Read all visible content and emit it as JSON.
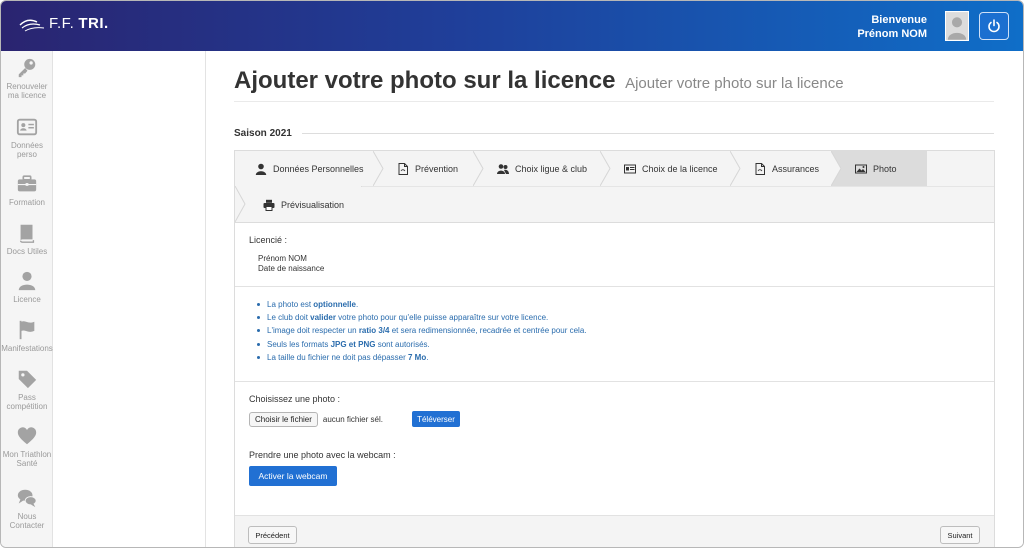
{
  "header": {
    "logo_prefix": "F.F.",
    "logo_tri": "TRI.",
    "welcome": "Bienvenue",
    "user_name": "Prénom NOM"
  },
  "sidebar": {
    "items": [
      {
        "label": "Renouveler ma licence",
        "icon": "key-icon"
      },
      {
        "label": "Données perso",
        "icon": "id-card-icon"
      },
      {
        "label": "Formation",
        "icon": "briefcase-icon"
      },
      {
        "label": "Docs Utiles",
        "icon": "book-icon"
      },
      {
        "label": "Licence",
        "icon": "user-icon"
      },
      {
        "label": "Manifestations",
        "icon": "flag-icon"
      },
      {
        "label": "Pass compétition",
        "icon": "tag-icon"
      },
      {
        "label": "Mon Triathlon Santé",
        "icon": "heart-icon"
      },
      {
        "label": "Nous Contacter",
        "icon": "chat-icon"
      }
    ]
  },
  "page": {
    "title": "Ajouter votre photo sur la licence",
    "subtitle": "Ajouter votre photo sur la licence",
    "season": "Saison 2021"
  },
  "steps": [
    {
      "label": "Données Personnelles",
      "icon": "user-icon",
      "active": false
    },
    {
      "label": "Prévention",
      "icon": "document-icon",
      "active": false
    },
    {
      "label": "Choix ligue & club",
      "icon": "users-icon",
      "active": false
    },
    {
      "label": "Choix de la licence",
      "icon": "id-card-icon",
      "active": false
    },
    {
      "label": "Assurances",
      "icon": "document-icon",
      "active": false
    },
    {
      "label": "Photo",
      "icon": "image-icon",
      "active": true
    },
    {
      "label": "Prévisualisation",
      "icon": "printer-icon",
      "active": false
    }
  ],
  "licencie": {
    "label": "Licencié :",
    "name": "Prénom NOM",
    "birth": "Date de naissance"
  },
  "infos": {
    "i1_a": "La photo est ",
    "i1_b": "optionnelle",
    "i1_c": ".",
    "i2_a": "Le club doit ",
    "i2_b": "valider",
    "i2_c": " votre photo pour qu'elle puisse apparaître sur votre licence.",
    "i3_a": "L'image doit respecter un ",
    "i3_b": "ratio 3/4",
    "i3_c": " et sera redimensionnée, recadrée et centrée pour cela.",
    "i4_a": "Seuls les formats ",
    "i4_b": "JPG et PNG",
    "i4_c": " sont autorisés.",
    "i5_a": "La taille du fichier ne doit pas dépasser ",
    "i5_b": "7 Mo",
    "i5_c": "."
  },
  "upload": {
    "label": "Choisissez une photo :",
    "choose_button": "Choisir le fichier",
    "no_file": "aucun fichier sél.",
    "upload_button": "Téléverser",
    "webcam_label": "Prendre une photo avec la webcam :",
    "webcam_button": "Activer la webcam"
  },
  "footer": {
    "prev": "Précédent",
    "next": "Suivant"
  },
  "colors": {
    "header_start": "#2a2470",
    "header_end": "#0f6ec8",
    "primary_button": "#2170d3",
    "info_text": "#2a6cad"
  }
}
